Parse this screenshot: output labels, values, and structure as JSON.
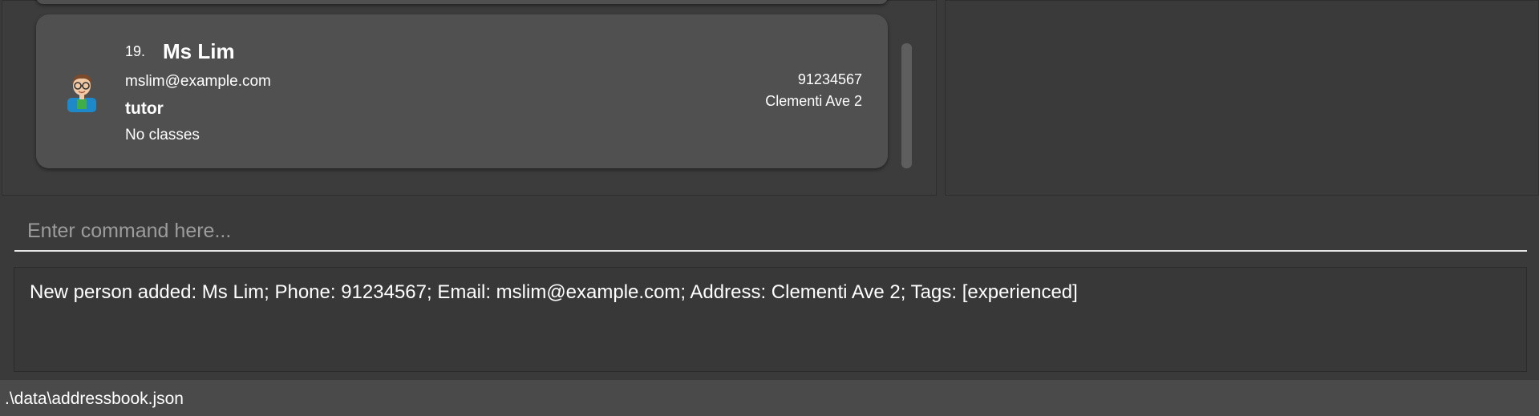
{
  "person_card": {
    "index": "19.",
    "name": "Ms Lim",
    "email": "mslim@example.com",
    "role": "tutor",
    "classes": "No classes",
    "phone": "91234567",
    "address": "Clementi Ave 2",
    "avatar_icon": "tutor-avatar-icon"
  },
  "command": {
    "placeholder": "Enter command here...",
    "value": ""
  },
  "result": {
    "message": "New person added: Ms Lim; Phone: 91234567; Email: mslim@example.com; Address: Clementi Ave 2; Tags: [experienced]"
  },
  "status_bar": {
    "file_path": ".\\data\\addressbook.json"
  },
  "colors": {
    "background": "#3a3a3a",
    "card": "#515050",
    "status_bar": "#4a4a4a"
  }
}
